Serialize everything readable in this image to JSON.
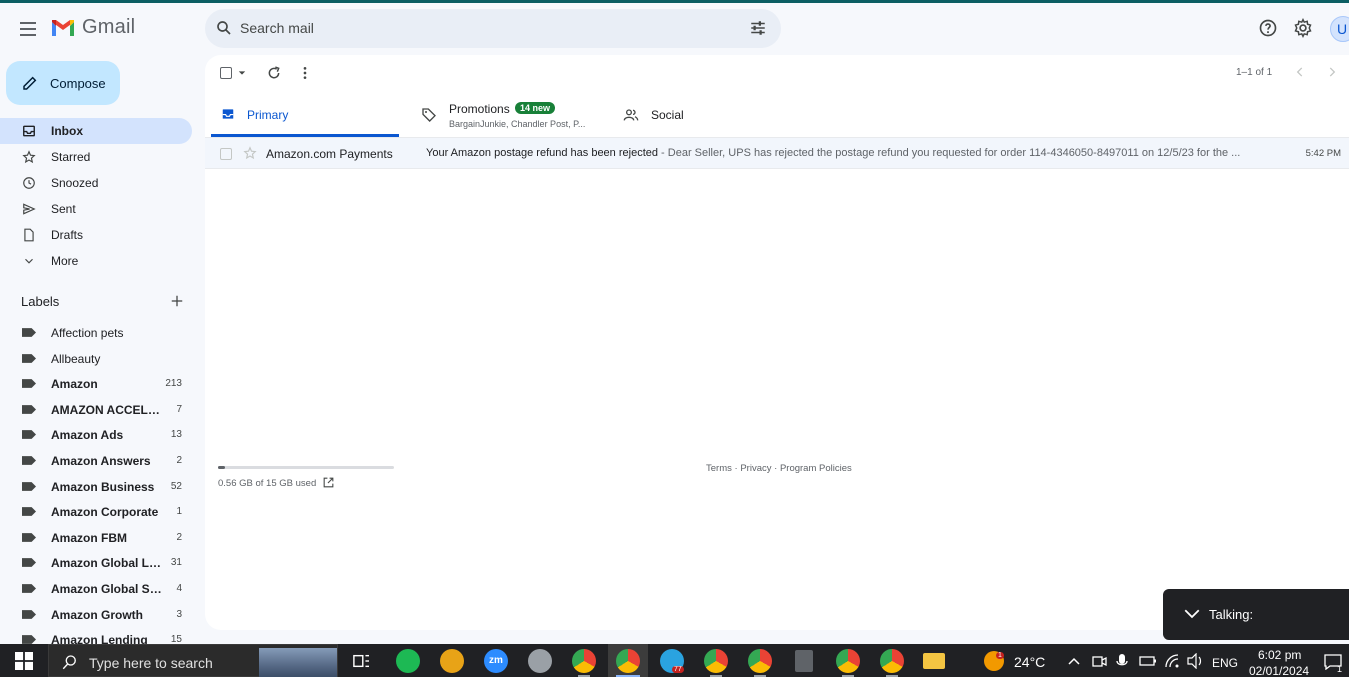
{
  "app": {
    "name": "Gmail"
  },
  "search": {
    "placeholder": "Search mail"
  },
  "header": {
    "avatar_initial": "U"
  },
  "compose": {
    "label": "Compose"
  },
  "nav": [
    {
      "label": "Inbox",
      "icon": "inbox-icon",
      "active": true
    },
    {
      "label": "Starred",
      "icon": "star-icon"
    },
    {
      "label": "Snoozed",
      "icon": "clock-icon"
    },
    {
      "label": "Sent",
      "icon": "send-icon"
    },
    {
      "label": "Drafts",
      "icon": "draft-icon"
    },
    {
      "label": "More",
      "icon": "chevron-down-icon"
    }
  ],
  "labels": {
    "title": "Labels",
    "items": [
      {
        "label": "Affection pets",
        "count": "",
        "bold": false
      },
      {
        "label": "Allbeauty",
        "count": "",
        "bold": false
      },
      {
        "label": "Amazon",
        "count": "213",
        "bold": true
      },
      {
        "label": "AMAZON ACCELER...",
        "count": "7",
        "bold": true
      },
      {
        "label": "Amazon Ads",
        "count": "13",
        "bold": true
      },
      {
        "label": "Amazon Answers",
        "count": "2",
        "bold": true
      },
      {
        "label": "Amazon Business",
        "count": "52",
        "bold": true
      },
      {
        "label": "Amazon Corporate",
        "count": "1",
        "bold": true
      },
      {
        "label": "Amazon FBM",
        "count": "2",
        "bold": true
      },
      {
        "label": "Amazon Global Lo...",
        "count": "31",
        "bold": true
      },
      {
        "label": "Amazon Global Sell...",
        "count": "4",
        "bold": true
      },
      {
        "label": "Amazon Growth",
        "count": "3",
        "bold": true
      },
      {
        "label": "Amazon Lending",
        "count": "15",
        "bold": true
      }
    ]
  },
  "toolbar": {
    "pager": "1–1 of 1"
  },
  "tabs": {
    "primary": "Primary",
    "promotions": "Promotions",
    "promotions_badge": "14 new",
    "promotions_sub": "BargainJunkie, Chandler Post, P...",
    "social": "Social"
  },
  "emails": [
    {
      "sender": "Amazon.com Payments",
      "subject": "Your Amazon postage refund has been rejected",
      "preview": " - Dear Seller, UPS has rejected the postage refund you requested for order 114-4346050-8497011 on 12/5/23 for the ...",
      "time": "5:42 PM"
    }
  ],
  "storage": {
    "text": "0.56 GB of 15 GB used",
    "used_fraction": 0.037
  },
  "footer": {
    "terms": "Terms",
    "privacy": "Privacy",
    "policies": "Program Policies"
  },
  "talking": {
    "label": "Talking:"
  },
  "taskbar": {
    "search_placeholder": "Type here to search",
    "weather": "24°C",
    "language": "ENG",
    "time": "6:02 pm",
    "date": "02/01/2024",
    "telegram_badge": "77",
    "weather_badge": "1",
    "notif_count": "1"
  }
}
